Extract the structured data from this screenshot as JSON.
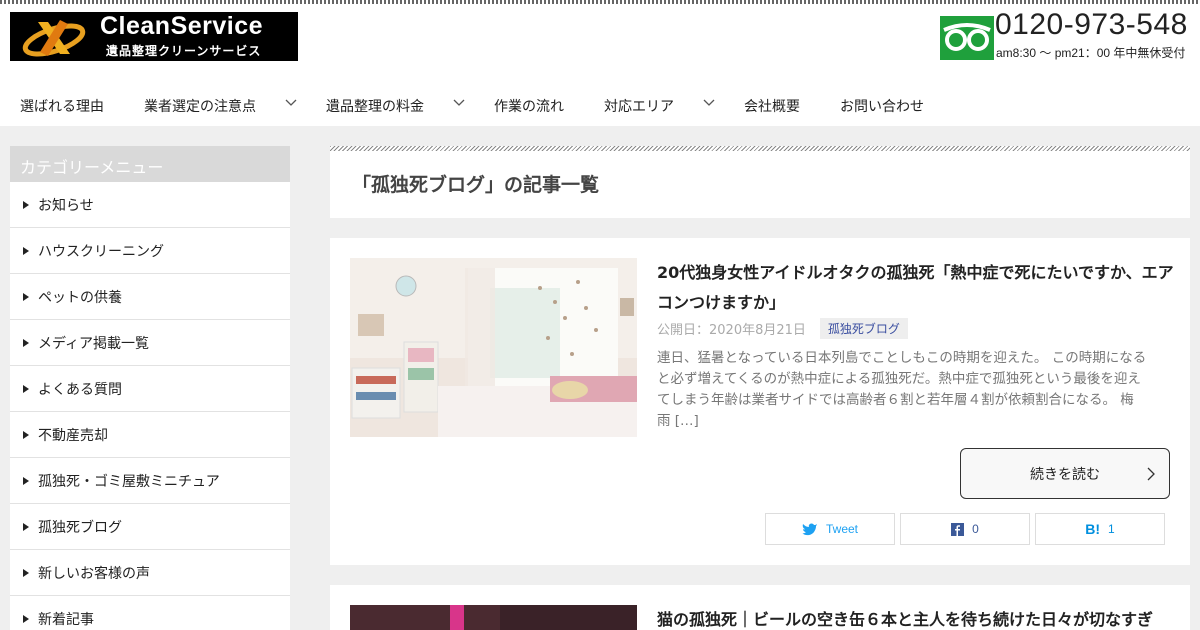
{
  "header": {
    "logo_title": "CleanService",
    "logo_subtitle": "遺品整理クリーンサービス",
    "phone_number": "0120-973-548",
    "phone_hours": "am8:30 ～ pm21：00 年中無休受付"
  },
  "nav": {
    "items": [
      {
        "label": "選ばれる理由"
      },
      {
        "label": "業者選定の注意点"
      },
      {
        "label": "遺品整理の料金"
      },
      {
        "label": "作業の流れ"
      },
      {
        "label": "対応エリア"
      },
      {
        "label": "会社概要"
      },
      {
        "label": "お問い合わせ"
      }
    ]
  },
  "sidebar": {
    "title": "カテゴリーメニュー",
    "items": [
      {
        "label": "お知らせ"
      },
      {
        "label": "ハウスクリーニング"
      },
      {
        "label": "ペットの供養"
      },
      {
        "label": "メディア掲載一覧"
      },
      {
        "label": "よくある質問"
      },
      {
        "label": "不動産売却"
      },
      {
        "label": "孤独死・ゴミ屋敷ミニチュア"
      },
      {
        "label": "孤独死ブログ"
      },
      {
        "label": "新しいお客様の声"
      },
      {
        "label": "新着記事"
      }
    ]
  },
  "archive": {
    "title": "「孤独死ブログ」の記事一覧"
  },
  "posts": [
    {
      "title": "20代独身女性アイドルオタクの孤独死「熱中症で死にたいですか、エアコンつけますか」",
      "published": "公開日：2020年8月21日",
      "category": "孤独死ブログ",
      "excerpt": "連日、猛暑となっている日本列島でことしもこの時期を迎えた。 この時期になると必ず増えてくるのが熱中症による孤独死だ。熱中症で孤独死という最後を迎えてしまう年齢は業者サイドでは高齢者６割と若年層４割が依頼割合になる。 梅雨 […]",
      "read_more": "続きを読む",
      "share": {
        "tweet_label": "Tweet",
        "facebook_count": "0",
        "hatena_glyph": "B!",
        "hatena_count": "1"
      }
    },
    {
      "title": "猫の孤独死｜ビールの空き缶６本と主人を待ち続けた日々が切なすぎ"
    }
  ],
  "colors": {
    "phone_green": "#1fa03c",
    "twitter_blue": "#1da1f2",
    "facebook_blue": "#3b5998",
    "hatena_blue": "#008fde",
    "badge_text": "#3a4ea0"
  }
}
